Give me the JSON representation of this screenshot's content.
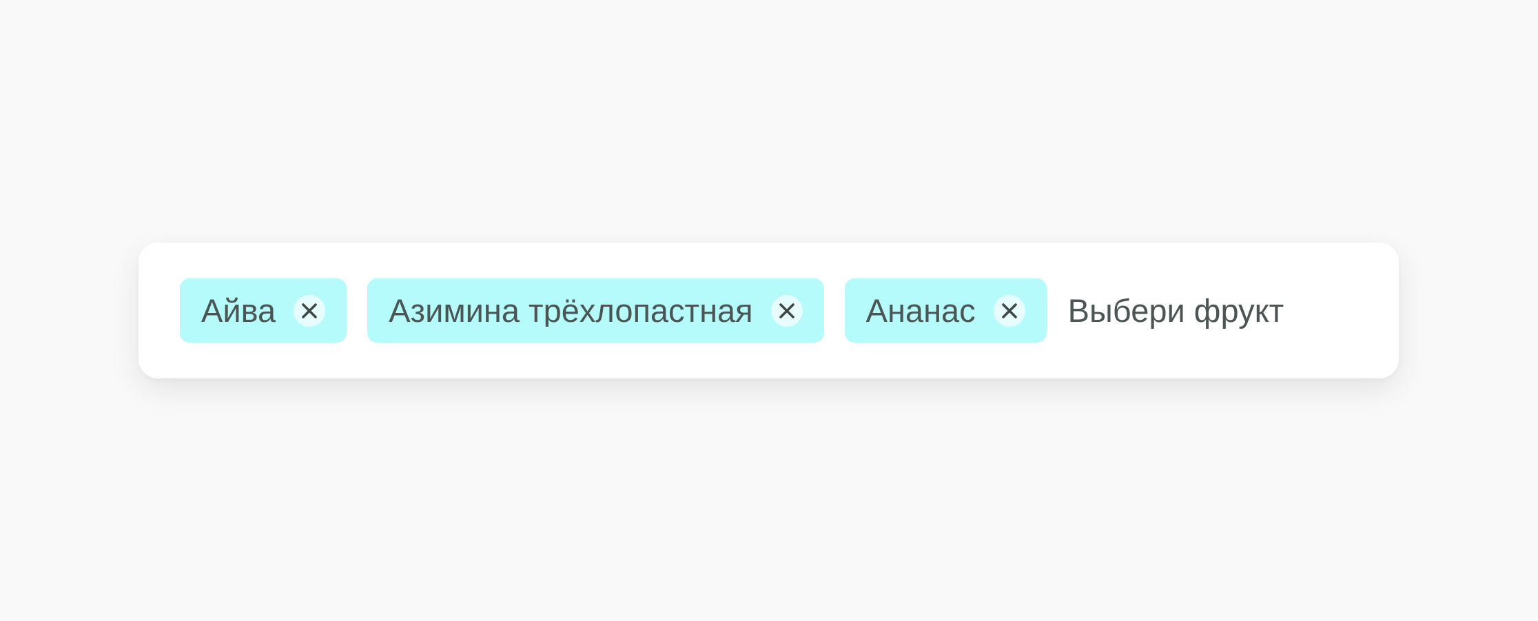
{
  "multiselect": {
    "chips": [
      {
        "label": "Айва",
        "remove_icon": "close-icon"
      },
      {
        "label": "Азимина трёхлопастная",
        "remove_icon": "close-icon"
      },
      {
        "label": "Ананас",
        "remove_icon": "close-icon"
      }
    ],
    "input": {
      "value": "",
      "placeholder": "Выбери фрукт"
    }
  },
  "colors": {
    "page_background": "#f9f9f9",
    "field_background": "#ffffff",
    "chip_background": "#b5fbfb",
    "chip_remove_background": "#e7fdfd",
    "text": "#4b5553"
  }
}
